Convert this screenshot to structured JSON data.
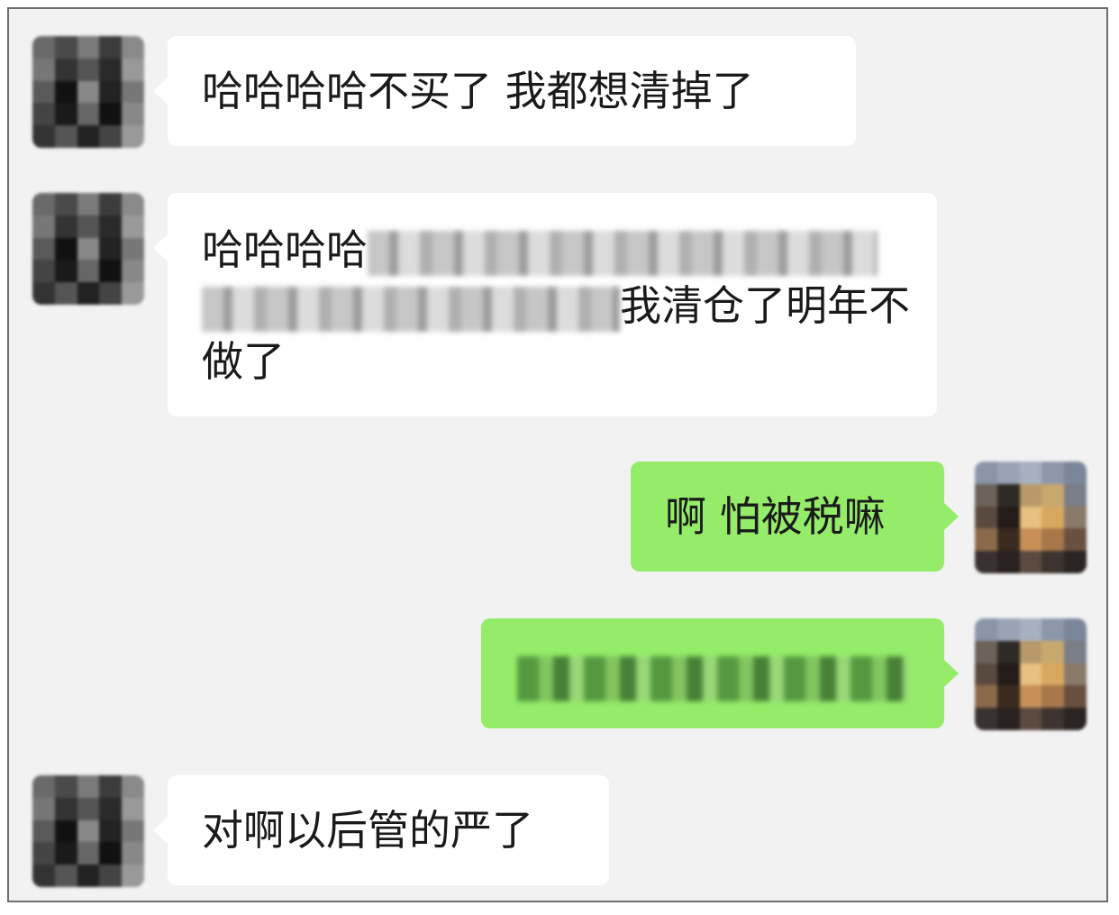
{
  "colors": {
    "background": "#f2f2f2",
    "incoming_bubble": "#ffffff",
    "outgoing_bubble": "#95ec69",
    "text": "#1a1a1a"
  },
  "messages": [
    {
      "direction": "incoming",
      "text": "哈哈哈哈不买了 我都想清掉了"
    },
    {
      "direction": "incoming",
      "text_before_redaction": "哈哈哈哈",
      "text_after_redaction": "我清仓了明年不做了",
      "has_redaction": true
    },
    {
      "direction": "outgoing",
      "text": "啊 怕被税嘛"
    },
    {
      "direction": "outgoing",
      "text": "",
      "has_redaction": true
    },
    {
      "direction": "incoming",
      "text": "对啊以后管的严了"
    }
  ],
  "avatars": {
    "contact": "pixelated-avatar",
    "self": "pixelated-sunset-avatar"
  }
}
